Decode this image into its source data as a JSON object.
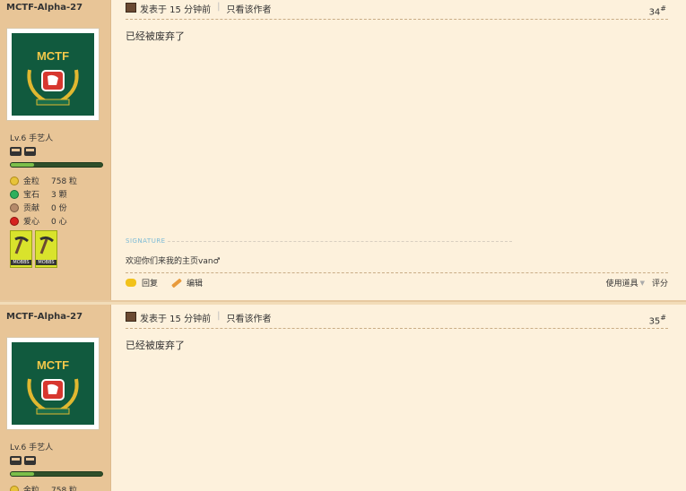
{
  "posts": [
    {
      "username": "MCTF-Alpha-27",
      "avatar_text": "MCTF",
      "level": "Lv.6 手艺人",
      "level_progress": 0.25,
      "stats": [
        {
          "label": "金粒",
          "value": "758 粒",
          "icon": "gold-nugget-icon"
        },
        {
          "label": "宝石",
          "value": "3 颗",
          "icon": "emerald-icon"
        },
        {
          "label": "贡献",
          "value": "0 份",
          "icon": "contribution-icon"
        },
        {
          "label": "爱心",
          "value": "0 心",
          "icon": "heart-icon"
        }
      ],
      "medals": [
        {
          "tag": "MOBBS"
        },
        {
          "tag": "MOBBS"
        }
      ],
      "posted": "发表于 15 分钟前",
      "author_only": "只看该作者",
      "floor": "34",
      "floor_mark": "#",
      "message": "已经被废弃了",
      "signature_label": "SIGNATURE",
      "signature_text": "欢迎你们来我的主页van♂",
      "actions": {
        "reply": "回复",
        "edit": "编辑",
        "use_item": "使用道具",
        "rate": "评分"
      }
    },
    {
      "username": "MCTF-Alpha-27",
      "avatar_text": "MCTF",
      "level": "Lv.6 手艺人",
      "level_progress": 0.25,
      "stats": [
        {
          "label": "金粒",
          "value": "758 粒",
          "icon": "gold-nugget-icon"
        }
      ],
      "posted": "发表于 15 分钟前",
      "author_only": "只看该作者",
      "floor": "35",
      "floor_mark": "#",
      "message": "已经被废弃了"
    }
  ],
  "colors": {
    "sidebar": "#e8c597",
    "background": "#fdf1dc",
    "avatar_bg": "#115a3e",
    "logo": "#f2c84a"
  }
}
